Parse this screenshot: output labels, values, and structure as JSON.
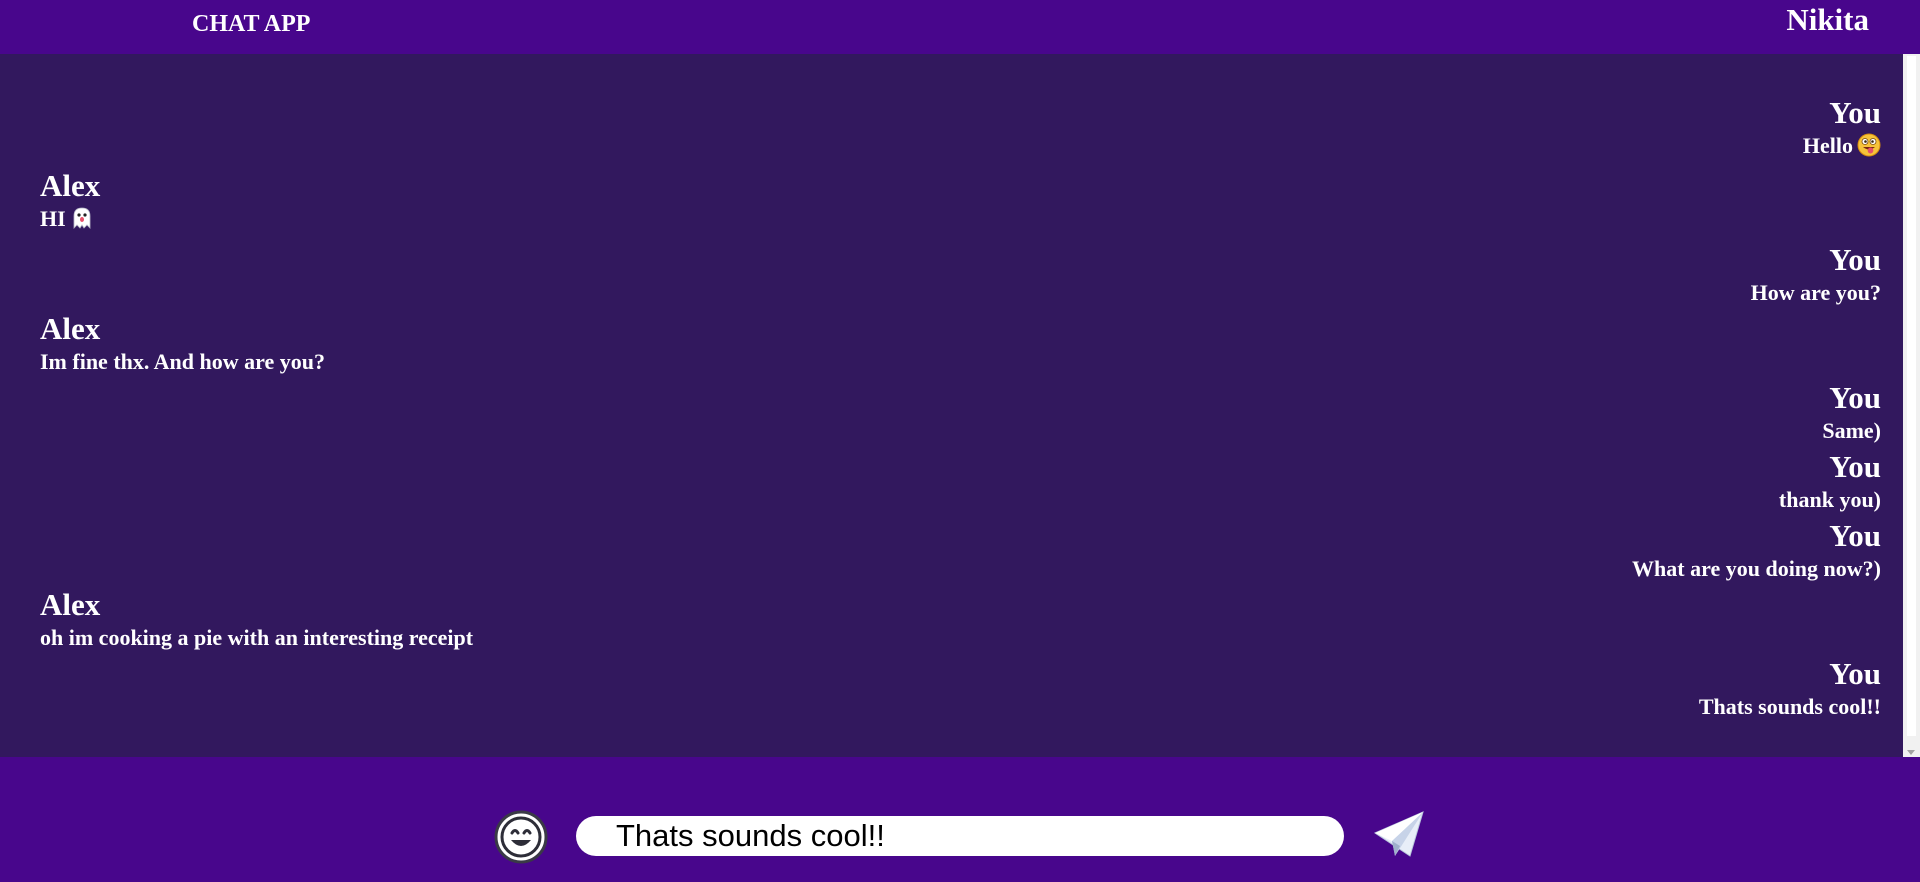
{
  "header": {
    "app_title": "CHAT APP",
    "user_name": "Nikita"
  },
  "messages": [
    {
      "sender": "You",
      "text": "Hello",
      "side": "right",
      "emoji": "face-with-tongue-emoji"
    },
    {
      "sender": "Alex",
      "text": "HI",
      "side": "left",
      "emoji": "ghost-emoji"
    },
    {
      "sender": "You",
      "text": "How are you?",
      "side": "right"
    },
    {
      "sender": "Alex",
      "text": "Im fine thx. And how are you?",
      "side": "left"
    },
    {
      "sender": "You",
      "text": "Same)",
      "side": "right"
    },
    {
      "sender": "You",
      "text": "thank you)",
      "side": "right"
    },
    {
      "sender": "You",
      "text": "What are you doing now?)",
      "side": "right"
    },
    {
      "sender": "Alex",
      "text": "oh im cooking a pie with an interesting receipt",
      "side": "left"
    },
    {
      "sender": "You",
      "text": "Thats sounds cool!!",
      "side": "right"
    }
  ],
  "composer": {
    "value": "Thats sounds cool!!",
    "emoji_icon": "smiley-face-icon",
    "send_icon": "paper-plane-icon"
  },
  "colors": {
    "header_bg": "#48068c",
    "chat_bg": "#32185e",
    "text": "#ffffff"
  }
}
